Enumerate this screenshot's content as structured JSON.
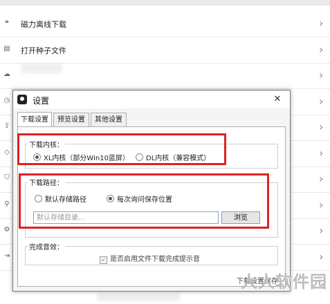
{
  "background_list": {
    "items": [
      {
        "icon": "magnet-icon",
        "glyph": "⚭",
        "label": "磁力离线下载"
      },
      {
        "icon": "file-icon",
        "glyph": "▤",
        "label": "打开种子文件"
      },
      {
        "icon": "cloud-icon",
        "glyph": "☁",
        "label": ""
      },
      {
        "icon": "clock-icon",
        "glyph": "◷",
        "label": ""
      },
      {
        "icon": "upload-icon",
        "glyph": "⇪",
        "label": ""
      },
      {
        "icon": "diamond-icon",
        "glyph": "◇",
        "label": ""
      },
      {
        "icon": "shield-icon",
        "glyph": "⛉",
        "label": ""
      },
      {
        "icon": "network-icon",
        "glyph": "⚲",
        "label": ""
      },
      {
        "icon": "gear-icon",
        "glyph": "⚙",
        "label": ""
      },
      {
        "icon": "exit-icon",
        "glyph": "⇥",
        "label": ""
      }
    ],
    "chevron": "›"
  },
  "dialog": {
    "title": "设置",
    "close_glyph": "✕",
    "tabs": [
      {
        "label": "下载设置",
        "active": true
      },
      {
        "label": "预览设置",
        "active": false
      },
      {
        "label": "其他设置",
        "active": false
      }
    ],
    "kernel": {
      "label": "下载内核：",
      "options": [
        {
          "label": "XL内核（部分Win10蓝屏）",
          "selected": true
        },
        {
          "label": "DL内核（兼容模式）",
          "selected": false
        }
      ]
    },
    "path": {
      "label": "下载路径：",
      "options": [
        {
          "label": "默认存储路径",
          "selected": false
        },
        {
          "label": "每次询问保存位置",
          "selected": true
        }
      ],
      "input_placeholder": "默认存储目录...",
      "browse_label": "浏览"
    },
    "sound": {
      "label": "完成音效：",
      "checkbox_label": "是否启用文件下载完成提示音",
      "checked": true
    },
    "footer_button": "下载设置保存"
  },
  "watermark": "人人软件园",
  "colors": {
    "highlight": "#e02020",
    "input_border": "#7aa6d8"
  }
}
